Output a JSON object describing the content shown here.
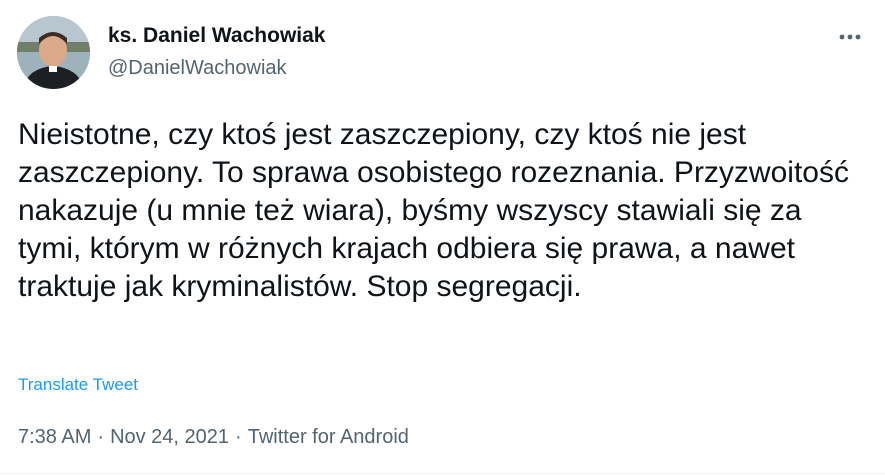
{
  "author": {
    "display_name": "ks. Daniel Wachowiak",
    "handle": "@DanielWachowiak",
    "avatar_icon": "profile-photo"
  },
  "more_icon": "more-horizontal-icon",
  "tweet": {
    "text": "Nieistotne, czy ktoś jest zaszczepiony, czy ktoś nie jest zaszczepiony. To sprawa osobistego rozeznania. Przyzwoitość nakazuje (u mnie też wiara), byśmy wszyscy stawiali się za tymi, którym w różnych krajach odbiera się prawa, a nawet traktuje jak kryminalistów. Stop segregacji.",
    "translate_label": "Translate Tweet"
  },
  "meta": {
    "time": "7:38 AM",
    "separator": "·",
    "date": "Nov 24, 2021",
    "source": "Twitter for Android"
  },
  "colors": {
    "text_primary": "#0f1419",
    "text_secondary": "#536471",
    "link": "#1d9bf0",
    "divider": "#eff3f4"
  }
}
